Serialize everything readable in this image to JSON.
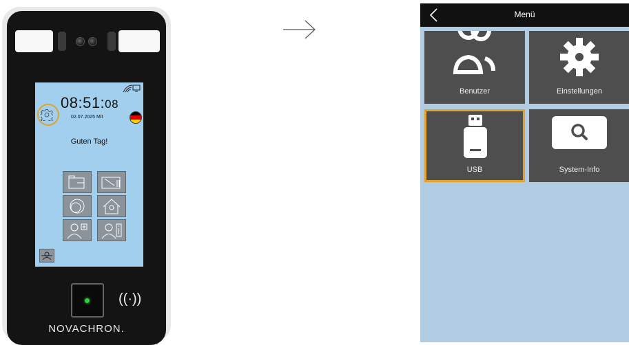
{
  "device": {
    "time_hm": "08:51:",
    "time_s": "08",
    "date": "02.07.2025 Mit",
    "greeting": "Guten Tag!",
    "brand": "NOVACHRON.",
    "rfid_symbol": "((·))",
    "settings_icon": "gear-icon",
    "highlight_color": "#e3a32a"
  },
  "menu": {
    "title": "Menü",
    "tiles": [
      {
        "label": "Benutzer",
        "icon": "users-icon"
      },
      {
        "label": "Einstellungen",
        "icon": "gear-icon"
      },
      {
        "label": "USB",
        "icon": "usb-icon",
        "selected": true
      },
      {
        "label": "System-Info",
        "icon": "search-icon"
      }
    ]
  },
  "colors": {
    "screen_bg": "#a3cfef",
    "menu_bg": "#b1cbe2",
    "tile_bg": "#4e4e4e",
    "accent": "#e3a32a"
  }
}
